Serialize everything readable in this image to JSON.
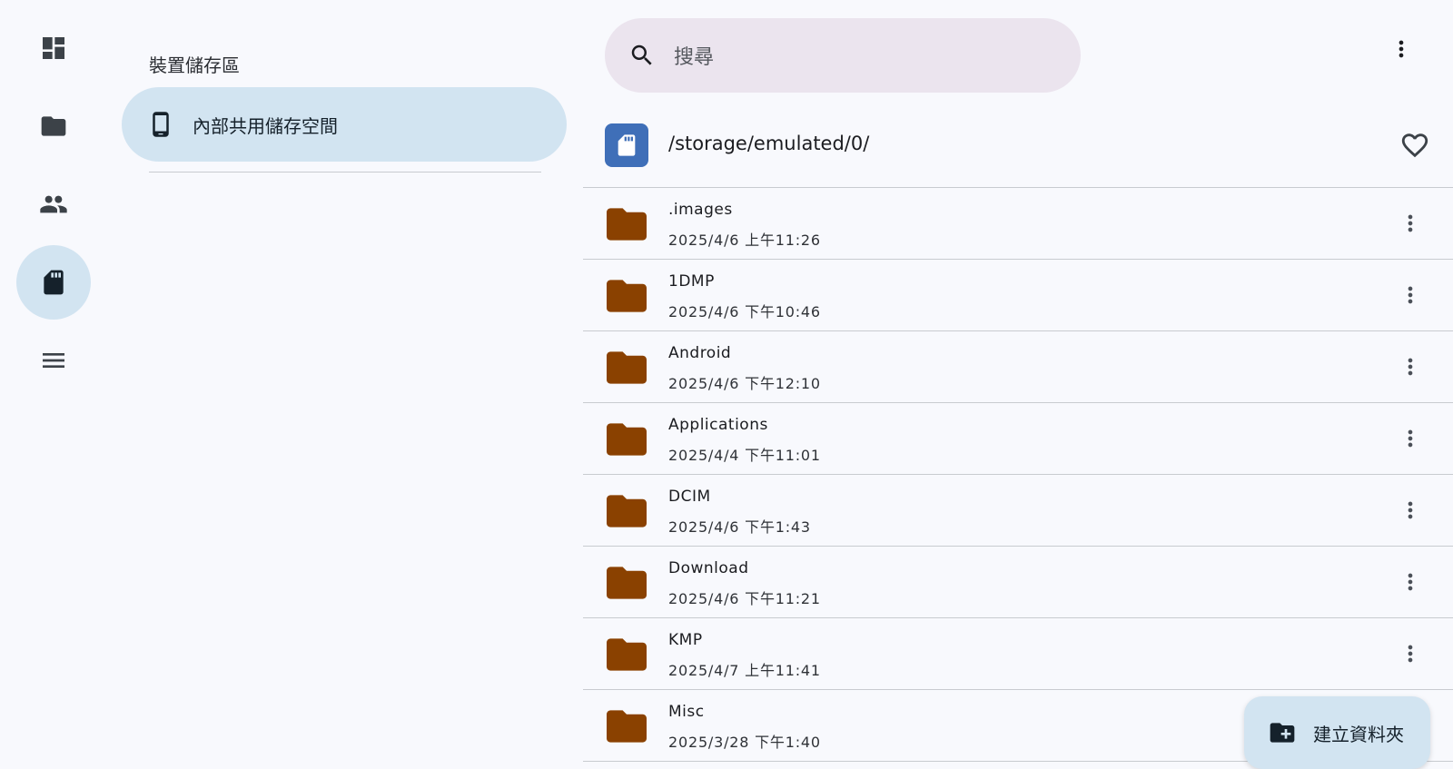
{
  "rail": {
    "items": [
      {
        "icon": "dashboard-icon",
        "active": false
      },
      {
        "icon": "folder-icon",
        "active": false
      },
      {
        "icon": "people-icon",
        "active": false
      },
      {
        "icon": "sd-card-icon",
        "active": true
      },
      {
        "icon": "menu-icon",
        "active": false
      }
    ]
  },
  "panel": {
    "title": "裝置儲存區",
    "storage_item": {
      "icon": "phone-icon",
      "label": "內部共用儲存空間"
    }
  },
  "search": {
    "icon": "search-icon",
    "placeholder": "搜尋"
  },
  "toolbar": {
    "more_icon": "more-vert-icon"
  },
  "path": {
    "icon": "sd-card-icon",
    "text": "/storage/emulated/0/",
    "favorite_icon": "heart-outline-icon"
  },
  "files": [
    {
      "name": ".images",
      "date": "2025/4/6 上午11:26"
    },
    {
      "name": "1DMP",
      "date": "2025/4/6 下午10:46"
    },
    {
      "name": "Android",
      "date": "2025/4/6 下午12:10"
    },
    {
      "name": "Applications",
      "date": "2025/4/4 下午11:01"
    },
    {
      "name": "DCIM",
      "date": "2025/4/6 下午1:43"
    },
    {
      "name": "Download",
      "date": "2025/4/6 下午11:21"
    },
    {
      "name": "KMP",
      "date": "2025/4/7 上午11:41"
    },
    {
      "name": "Misc",
      "date": "2025/3/28 下午1:40"
    }
  ],
  "fab": {
    "icon": "create-folder-icon",
    "label": "建立資料夾"
  },
  "colors": {
    "background": "#f8f9fd",
    "accent_container": "#d2e4f1",
    "search_background": "#ebe4ee",
    "folder": "#8a4100",
    "path_icon_background": "#3f6fb8"
  }
}
